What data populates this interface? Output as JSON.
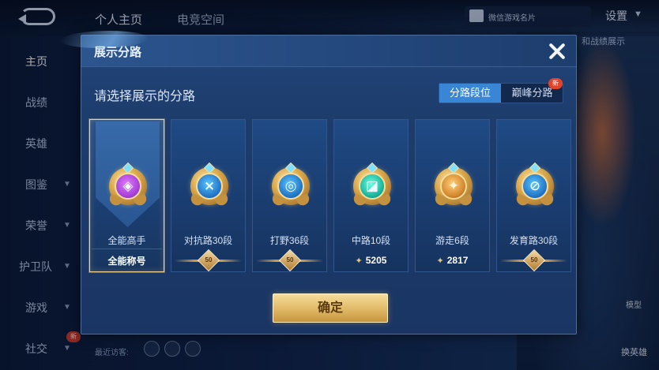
{
  "topbar": {
    "tabs": [
      "个人主页",
      "电竞空间"
    ],
    "profile_chip": "微信游戏名片",
    "settings": "设置",
    "side_caption": "和战绩展示"
  },
  "sidebar": {
    "items": [
      {
        "label": "主页",
        "active": true
      },
      {
        "label": "战绩"
      },
      {
        "label": "英雄"
      },
      {
        "label": "图鉴"
      },
      {
        "label": "荣誉"
      },
      {
        "label": "护卫队"
      },
      {
        "label": "游戏"
      },
      {
        "label": "社交"
      }
    ],
    "new_badge": "新"
  },
  "footer": {
    "visitors_label": "最近访客:",
    "model_label": "模型",
    "swap_label": "换英雄"
  },
  "modal": {
    "title": "展示分路",
    "prompt": "请选择展示的分路",
    "tabs": [
      {
        "label": "分路段位",
        "active": true
      },
      {
        "label": "巅峰分路"
      }
    ],
    "tab_new_badge": "新",
    "cards": [
      {
        "title": "全能高手",
        "footer": "全能称号",
        "footer_type": "text",
        "emblem": "purple",
        "glyph": "◈",
        "selected": true
      },
      {
        "title": "对抗路30段",
        "footer": "50",
        "footer_type": "badge",
        "emblem": "blue",
        "glyph": "⨯"
      },
      {
        "title": "打野36段",
        "footer": "50",
        "footer_type": "badge",
        "emblem": "blue",
        "glyph": "◎"
      },
      {
        "title": "中路10段",
        "footer": "5205",
        "footer_type": "score",
        "emblem": "teal",
        "glyph": "◪"
      },
      {
        "title": "游走6段",
        "footer": "2817",
        "footer_type": "score",
        "emblem": "amber",
        "glyph": "✦"
      },
      {
        "title": "发育路30段",
        "footer": "50",
        "footer_type": "badge",
        "emblem": "blue",
        "glyph": "⊘"
      }
    ],
    "confirm": "确定",
    "close_icon": "close-icon"
  }
}
